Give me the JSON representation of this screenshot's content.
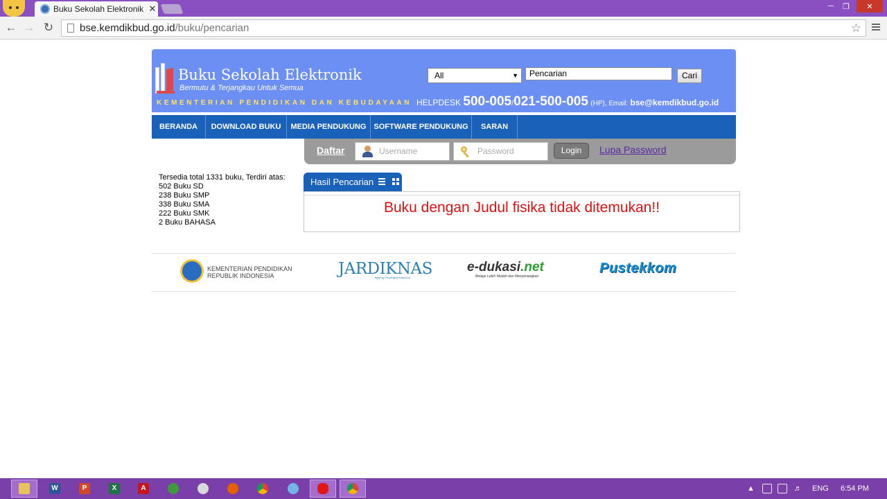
{
  "browser": {
    "tab_title": "Buku Sekolah Elektronik",
    "tab_close": "✕",
    "url_host": "bse.kemdikbud.go.id",
    "url_path": "/buku/pencarian"
  },
  "header": {
    "site_title": "Buku Sekolah Elektronik",
    "tagline": "Bermutu & Terjangkau Untuk Semua",
    "ministry": "KEMENTERIAN PENDIDIKAN DAN KEBUDAYAAN",
    "category_value": "All",
    "search_value": "Pencarian",
    "search_button": "Cari",
    "helpdesk": {
      "label": "HELPDESK",
      "phone1": "500-005",
      "sep": "/",
      "phone2": "021-500-005",
      "hp": "(HP), Email:",
      "email": "bse@kemdikbud.go.id"
    }
  },
  "nav": [
    "BERANDA",
    "DOWNLOAD BUKU",
    "MEDIA PENDUKUNG",
    "SOFTWARE PENDUKUNG",
    "SARAN"
  ],
  "login": {
    "register": "Daftar",
    "username_placeholder": "Username",
    "password_placeholder": "Password",
    "login_button": "Login",
    "forgot": "Lupa Password"
  },
  "stats": {
    "total": "Tersedia total 1331 buku, Terdiri atas:",
    "items": [
      "502 Buku SD",
      "238 Buku SMP",
      "338 Buku SMA",
      "222 Buku SMK",
      "2 Buku BAHASA"
    ]
  },
  "results": {
    "tab_label": "Hasil Pencarian",
    "message": "Buku dengan Judul fisika tidak ditemukan!!"
  },
  "partners": {
    "kemdikbud_line1": "KEMENTERIAN PENDIDIKAN",
    "kemdikbud_line2": "REPUBLIK INDONESIA",
    "jardiknas": "JARDIKNAS",
    "jardiknas_sub": "Jejaring Pendidikan Nasional",
    "edukasi_a": "e-dukasi",
    "edukasi_b": ".net",
    "edukasi_sub": "Belajar Lebih Mudah dan Menyenangkan",
    "pustekkom": "Pustekkom"
  },
  "taskbar": {
    "apps": [
      "file-explorer",
      "word",
      "powerpoint",
      "excel",
      "acrobat",
      "globe",
      "paint",
      "firefox",
      "chrome",
      "app",
      "red-app",
      "chrome-active"
    ],
    "language": "ENG",
    "time": "6:54 PM"
  }
}
